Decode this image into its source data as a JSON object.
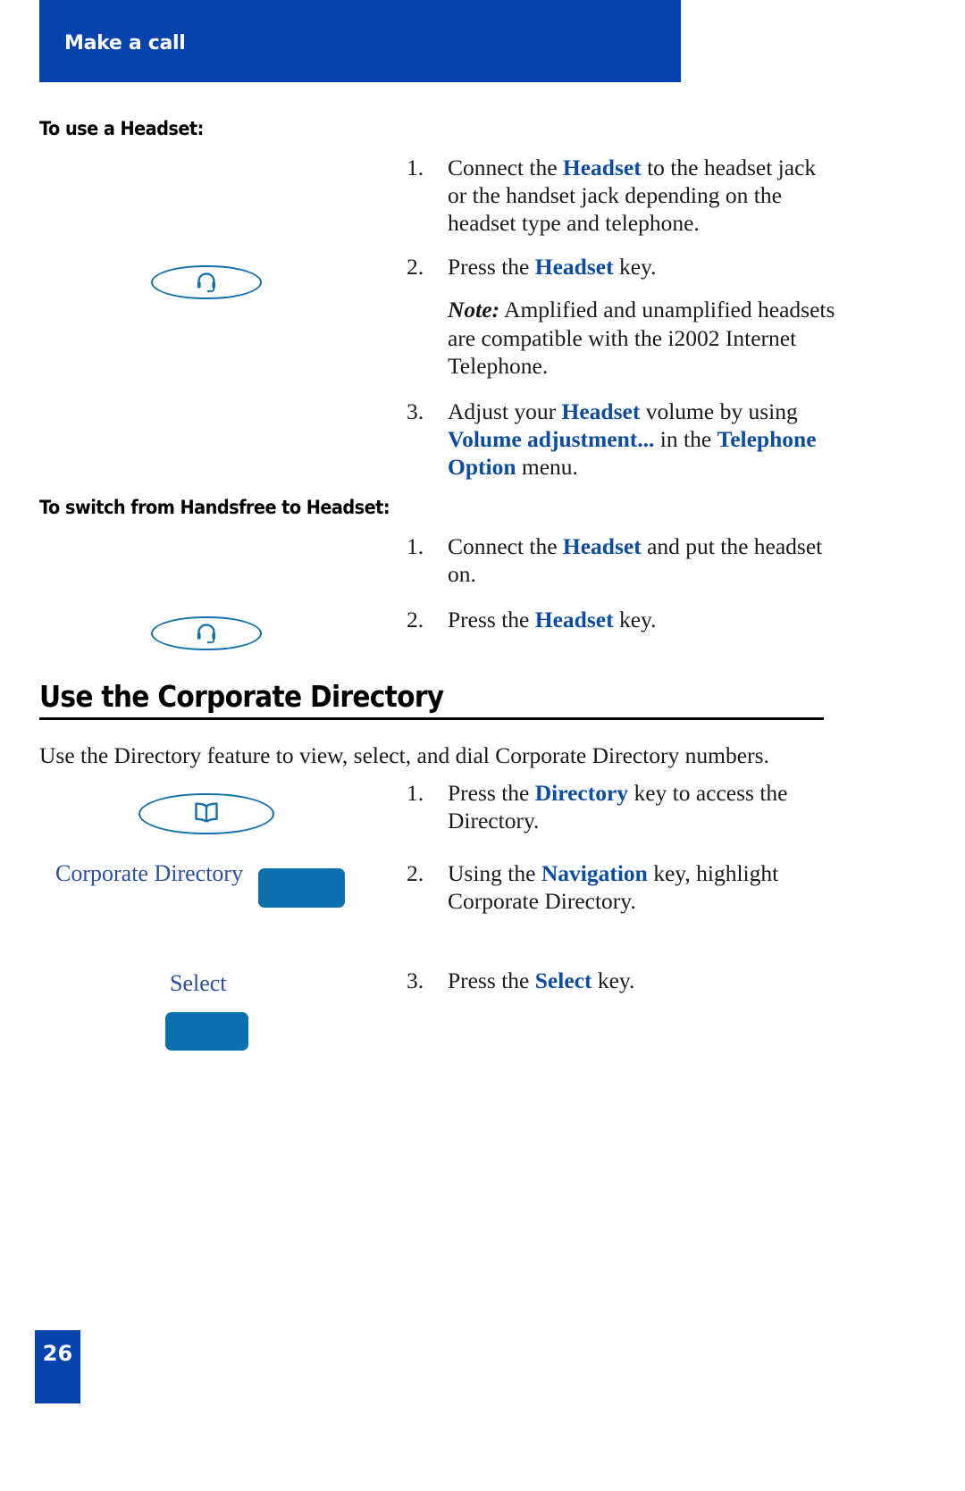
{
  "header": {
    "running_title": "Make a call"
  },
  "sections": {
    "headset": {
      "subheading": "To use a Headset:",
      "steps": [
        {
          "number": "1.",
          "parts": [
            {
              "text": "Connect the ",
              "style": "plain"
            },
            {
              "text": "Headset",
              "style": "keyword"
            },
            {
              "text": " to the headset jack or the handset jack depending on the headset type and telephone.",
              "style": "plain"
            }
          ]
        },
        {
          "number": "2.",
          "parts": [
            {
              "text": "Press the ",
              "style": "plain"
            },
            {
              "text": "Headset",
              "style": "keyword"
            },
            {
              "text": " key.",
              "style": "plain"
            }
          ]
        },
        {
          "number": "3.",
          "parts": [
            {
              "text": "Adjust your ",
              "style": "plain"
            },
            {
              "text": "Headset",
              "style": "keyword"
            },
            {
              "text": " volume by using ",
              "style": "plain"
            },
            {
              "text": "Volume adjustment...",
              "style": "keyword"
            },
            {
              "text": " in the ",
              "style": "plain"
            },
            {
              "text": "Telephone Option",
              "style": "keyword"
            },
            {
              "text": " menu.",
              "style": "plain"
            }
          ]
        }
      ],
      "note": {
        "label": "Note:",
        "text": " Amplified and unamplified headsets are compatible with the i2002 Internet Telephone."
      },
      "key_icon": "headset-icon"
    },
    "handsfree": {
      "subheading": "To switch from Handsfree to Headset:",
      "steps": [
        {
          "number": "1.",
          "parts": [
            {
              "text": "Connect the ",
              "style": "plain"
            },
            {
              "text": "Headset",
              "style": "keyword"
            },
            {
              "text": " and put the headset on.",
              "style": "plain"
            }
          ]
        },
        {
          "number": "2.",
          "parts": [
            {
              "text": "Press the ",
              "style": "plain"
            },
            {
              "text": "Headset",
              "style": "keyword"
            },
            {
              "text": " key.",
              "style": "plain"
            }
          ]
        }
      ],
      "key_icon": "headset-icon"
    },
    "directory": {
      "heading": "Use the Corporate Directory",
      "intro": "Use the Directory feature to view, select, and dial Corporate Directory numbers.",
      "steps": [
        {
          "number": "1.",
          "parts": [
            {
              "text": "Press the ",
              "style": "plain"
            },
            {
              "text": "Directory",
              "style": "keyword"
            },
            {
              "text": " key to access the Directory.",
              "style": "plain"
            }
          ]
        },
        {
          "number": "2.",
          "parts": [
            {
              "text": "Using the ",
              "style": "plain"
            },
            {
              "text": "Navigation",
              "style": "keyword"
            },
            {
              "text": " key, highlight Corporate Directory.",
              "style": "plain"
            }
          ]
        },
        {
          "number": "3.",
          "parts": [
            {
              "text": "Press the ",
              "style": "plain"
            },
            {
              "text": "Select",
              "style": "keyword"
            },
            {
              "text": " key.",
              "style": "plain"
            }
          ]
        }
      ],
      "key_icon": "open-book-icon",
      "display_labels": {
        "corporate_directory": "Corporate Directory",
        "select": "Select"
      }
    }
  },
  "footer": {
    "page_number": "26"
  },
  "colors": {
    "banner_blue": "#0544ac",
    "keyword_blue": "#0c4da2",
    "key_outline_blue": "#1070ad",
    "softkey_bar_blue": "#0b70ad",
    "display_text_blue": "#2b4fa2"
  }
}
